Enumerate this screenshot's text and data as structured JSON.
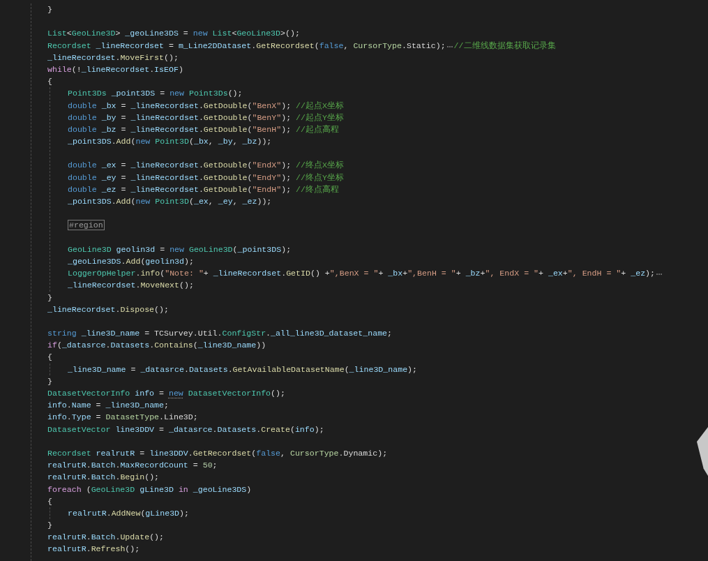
{
  "editor": {
    "lines": [
      {
        "kind": "code",
        "tokens": [
          {
            "kind": "plain",
            "text": "}"
          }
        ]
      },
      {
        "kind": "blank"
      },
      {
        "kind": "code",
        "tokens": [
          {
            "kind": "type",
            "text": "List"
          },
          {
            "kind": "plain",
            "text": "<"
          },
          {
            "kind": "type",
            "text": "GeoLine3D"
          },
          {
            "kind": "plain",
            "text": "> "
          },
          {
            "kind": "var",
            "text": "_geoLine3DS"
          },
          {
            "kind": "plain",
            "text": " = "
          },
          {
            "kind": "kw",
            "text": "new"
          },
          {
            "kind": "type",
            "text": " List"
          },
          {
            "kind": "plain",
            "text": "<"
          },
          {
            "kind": "type",
            "text": "GeoLine3D"
          },
          {
            "kind": "plain",
            "text": ">();"
          }
        ]
      },
      {
        "kind": "code",
        "tokens": [
          {
            "kind": "type",
            "text": "Recordset"
          },
          {
            "kind": "var",
            "text": " _lineRecordset"
          },
          {
            "kind": "plain",
            "text": " = "
          },
          {
            "kind": "var",
            "text": "m_Line2DDataset"
          },
          {
            "kind": "plain",
            "text": "."
          },
          {
            "kind": "method",
            "text": "GetRecordset"
          },
          {
            "kind": "plain",
            "text": "("
          },
          {
            "kind": "kw",
            "text": "false"
          },
          {
            "kind": "plain",
            "text": ", "
          },
          {
            "kind": "enum",
            "text": "CursorType"
          },
          {
            "kind": "plain",
            "text": ".Static);"
          },
          {
            "kind": "hint"
          },
          {
            "kind": "comment",
            "text": "//二维线数据集获取记录集"
          }
        ]
      },
      {
        "kind": "code",
        "tokens": [
          {
            "kind": "var",
            "text": "_lineRecordset"
          },
          {
            "kind": "plain",
            "text": "."
          },
          {
            "kind": "method",
            "text": "MoveFirst"
          },
          {
            "kind": "plain",
            "text": "();"
          }
        ]
      },
      {
        "kind": "code",
        "tokens": [
          {
            "kind": "ctrl",
            "text": "while"
          },
          {
            "kind": "plain",
            "text": "(!"
          },
          {
            "kind": "var",
            "text": "_lineRecordset"
          },
          {
            "kind": "plain",
            "text": "."
          },
          {
            "kind": "var",
            "text": "IsEOF"
          },
          {
            "kind": "plain",
            "text": ")"
          }
        ]
      },
      {
        "kind": "block",
        "open": "{",
        "close": "}",
        "children": [
          {
            "kind": "code",
            "tokens": [
              {
                "kind": "type",
                "text": "Point3Ds"
              },
              {
                "kind": "var",
                "text": " _point3DS"
              },
              {
                "kind": "plain",
                "text": " = "
              },
              {
                "kind": "kw",
                "text": "new"
              },
              {
                "kind": "type",
                "text": " Point3Ds"
              },
              {
                "kind": "plain",
                "text": "();"
              }
            ]
          },
          {
            "kind": "code",
            "tokens": [
              {
                "kind": "kw",
                "text": "double"
              },
              {
                "kind": "var",
                "text": " _bx"
              },
              {
                "kind": "plain",
                "text": " = "
              },
              {
                "kind": "var",
                "text": "_lineRecordset"
              },
              {
                "kind": "plain",
                "text": "."
              },
              {
                "kind": "method",
                "text": "GetDouble"
              },
              {
                "kind": "plain",
                "text": "("
              },
              {
                "kind": "str",
                "text": "\"BenX\""
              },
              {
                "kind": "plain",
                "text": "); "
              },
              {
                "kind": "comment",
                "text": "//起点X坐标"
              }
            ]
          },
          {
            "kind": "code",
            "tokens": [
              {
                "kind": "kw",
                "text": "double"
              },
              {
                "kind": "var",
                "text": " _by"
              },
              {
                "kind": "plain",
                "text": " = "
              },
              {
                "kind": "var",
                "text": "_lineRecordset"
              },
              {
                "kind": "plain",
                "text": "."
              },
              {
                "kind": "method",
                "text": "GetDouble"
              },
              {
                "kind": "plain",
                "text": "("
              },
              {
                "kind": "str",
                "text": "\"BenY\""
              },
              {
                "kind": "plain",
                "text": "); "
              },
              {
                "kind": "comment",
                "text": "//起点Y坐标"
              }
            ]
          },
          {
            "kind": "code",
            "tokens": [
              {
                "kind": "kw",
                "text": "double"
              },
              {
                "kind": "var",
                "text": " _bz"
              },
              {
                "kind": "plain",
                "text": " = "
              },
              {
                "kind": "var",
                "text": "_lineRecordset"
              },
              {
                "kind": "plain",
                "text": "."
              },
              {
                "kind": "method",
                "text": "GetDouble"
              },
              {
                "kind": "plain",
                "text": "("
              },
              {
                "kind": "str",
                "text": "\"BenH\""
              },
              {
                "kind": "plain",
                "text": "); "
              },
              {
                "kind": "comment",
                "text": "//起点高程"
              }
            ]
          },
          {
            "kind": "code",
            "tokens": [
              {
                "kind": "var",
                "text": "_point3DS"
              },
              {
                "kind": "plain",
                "text": "."
              },
              {
                "kind": "method",
                "text": "Add"
              },
              {
                "kind": "plain",
                "text": "("
              },
              {
                "kind": "kw",
                "text": "new"
              },
              {
                "kind": "type",
                "text": " Point3D"
              },
              {
                "kind": "plain",
                "text": "("
              },
              {
                "kind": "var",
                "text": "_bx"
              },
              {
                "kind": "plain",
                "text": ", "
              },
              {
                "kind": "var",
                "text": "_by"
              },
              {
                "kind": "plain",
                "text": ", "
              },
              {
                "kind": "var",
                "text": "_bz"
              },
              {
                "kind": "plain",
                "text": "));"
              }
            ]
          },
          {
            "kind": "blank"
          },
          {
            "kind": "code",
            "tokens": [
              {
                "kind": "kw",
                "text": "double"
              },
              {
                "kind": "var",
                "text": " _ex"
              },
              {
                "kind": "plain",
                "text": " = "
              },
              {
                "kind": "var",
                "text": "_lineRecordset"
              },
              {
                "kind": "plain",
                "text": "."
              },
              {
                "kind": "method",
                "text": "GetDouble"
              },
              {
                "kind": "plain",
                "text": "("
              },
              {
                "kind": "str",
                "text": "\"EndX\""
              },
              {
                "kind": "plain",
                "text": "); "
              },
              {
                "kind": "comment",
                "text": "//终点X坐标"
              }
            ]
          },
          {
            "kind": "code",
            "tokens": [
              {
                "kind": "kw",
                "text": "double"
              },
              {
                "kind": "var",
                "text": " _ey"
              },
              {
                "kind": "plain",
                "text": " = "
              },
              {
                "kind": "var",
                "text": "_lineRecordset"
              },
              {
                "kind": "plain",
                "text": "."
              },
              {
                "kind": "method",
                "text": "GetDouble"
              },
              {
                "kind": "plain",
                "text": "("
              },
              {
                "kind": "str",
                "text": "\"EndY\""
              },
              {
                "kind": "plain",
                "text": "); "
              },
              {
                "kind": "comment",
                "text": "//终点Y坐标"
              }
            ]
          },
          {
            "kind": "code",
            "tokens": [
              {
                "kind": "kw",
                "text": "double"
              },
              {
                "kind": "var",
                "text": " _ez"
              },
              {
                "kind": "plain",
                "text": " = "
              },
              {
                "kind": "var",
                "text": "_lineRecordset"
              },
              {
                "kind": "plain",
                "text": "."
              },
              {
                "kind": "method",
                "text": "GetDouble"
              },
              {
                "kind": "plain",
                "text": "("
              },
              {
                "kind": "str",
                "text": "\"EndH\""
              },
              {
                "kind": "plain",
                "text": "); "
              },
              {
                "kind": "comment",
                "text": "//终点高程"
              }
            ]
          },
          {
            "kind": "code",
            "tokens": [
              {
                "kind": "var",
                "text": "_point3DS"
              },
              {
                "kind": "plain",
                "text": "."
              },
              {
                "kind": "method",
                "text": "Add"
              },
              {
                "kind": "plain",
                "text": "("
              },
              {
                "kind": "kw",
                "text": "new"
              },
              {
                "kind": "type",
                "text": " Point3D"
              },
              {
                "kind": "plain",
                "text": "("
              },
              {
                "kind": "var",
                "text": "_ex"
              },
              {
                "kind": "plain",
                "text": ", "
              },
              {
                "kind": "var",
                "text": "_ey"
              },
              {
                "kind": "plain",
                "text": ", "
              },
              {
                "kind": "var",
                "text": "_ez"
              },
              {
                "kind": "plain",
                "text": "));"
              }
            ]
          },
          {
            "kind": "blank"
          },
          {
            "kind": "region",
            "text": "#region"
          },
          {
            "kind": "blank"
          },
          {
            "kind": "code",
            "tokens": [
              {
                "kind": "type",
                "text": "GeoLine3D"
              },
              {
                "kind": "var",
                "text": " geolin3d"
              },
              {
                "kind": "plain",
                "text": " = "
              },
              {
                "kind": "kw",
                "text": "new"
              },
              {
                "kind": "type",
                "text": " GeoLine3D"
              },
              {
                "kind": "plain",
                "text": "("
              },
              {
                "kind": "var",
                "text": "_point3DS"
              },
              {
                "kind": "plain",
                "text": ");"
              }
            ]
          },
          {
            "kind": "code",
            "tokens": [
              {
                "kind": "var",
                "text": "_geoLine3DS"
              },
              {
                "kind": "plain",
                "text": "."
              },
              {
                "kind": "method",
                "text": "Add"
              },
              {
                "kind": "plain",
                "text": "("
              },
              {
                "kind": "var",
                "text": "geolin3d"
              },
              {
                "kind": "plain",
                "text": ");"
              }
            ]
          },
          {
            "kind": "code",
            "tokens": [
              {
                "kind": "type",
                "text": "LoggerOpHelper"
              },
              {
                "kind": "plain",
                "text": "."
              },
              {
                "kind": "method",
                "text": "info"
              },
              {
                "kind": "plain",
                "text": "("
              },
              {
                "kind": "str",
                "text": "\"Note: \""
              },
              {
                "kind": "plain",
                "text": "+ "
              },
              {
                "kind": "var",
                "text": "_lineRecordset"
              },
              {
                "kind": "plain",
                "text": "."
              },
              {
                "kind": "method",
                "text": "GetID"
              },
              {
                "kind": "plain",
                "text": "() +"
              },
              {
                "kind": "str",
                "text": "\",BenX = \""
              },
              {
                "kind": "plain",
                "text": "+ "
              },
              {
                "kind": "var",
                "text": "_bx"
              },
              {
                "kind": "plain",
                "text": "+"
              },
              {
                "kind": "str",
                "text": "\",BenH = \""
              },
              {
                "kind": "plain",
                "text": "+ "
              },
              {
                "kind": "var",
                "text": "_bz"
              },
              {
                "kind": "plain",
                "text": "+"
              },
              {
                "kind": "str",
                "text": "\", EndX = \""
              },
              {
                "kind": "plain",
                "text": "+ "
              },
              {
                "kind": "var",
                "text": "_ex"
              },
              {
                "kind": "plain",
                "text": "+"
              },
              {
                "kind": "str",
                "text": "\", EndH = \""
              },
              {
                "kind": "plain",
                "text": "+ "
              },
              {
                "kind": "var",
                "text": "_ez"
              },
              {
                "kind": "plain",
                "text": ");"
              },
              {
                "kind": "hint"
              }
            ]
          },
          {
            "kind": "code",
            "tokens": [
              {
                "kind": "var",
                "text": "_lineRecordset"
              },
              {
                "kind": "plain",
                "text": "."
              },
              {
                "kind": "method",
                "text": "MoveNext"
              },
              {
                "kind": "plain",
                "text": "();"
              }
            ]
          }
        ]
      },
      {
        "kind": "code",
        "tokens": [
          {
            "kind": "var",
            "text": "_lineRecordset"
          },
          {
            "kind": "plain",
            "text": "."
          },
          {
            "kind": "method",
            "text": "Dispose"
          },
          {
            "kind": "plain",
            "text": "();"
          }
        ]
      },
      {
        "kind": "blank"
      },
      {
        "kind": "code",
        "tokens": [
          {
            "kind": "kw",
            "text": "string"
          },
          {
            "kind": "var",
            "text": " _line3D_name"
          },
          {
            "kind": "plain",
            "text": " = TCSurvey.Util."
          },
          {
            "kind": "type",
            "text": "ConfigStr"
          },
          {
            "kind": "plain",
            "text": "."
          },
          {
            "kind": "var",
            "text": "_all_line3D_dataset_name"
          },
          {
            "kind": "plain",
            "text": ";"
          }
        ]
      },
      {
        "kind": "code",
        "tokens": [
          {
            "kind": "ctrl",
            "text": "if"
          },
          {
            "kind": "plain",
            "text": "("
          },
          {
            "kind": "var",
            "text": "_datasrce"
          },
          {
            "kind": "plain",
            "text": "."
          },
          {
            "kind": "var",
            "text": "Datasets"
          },
          {
            "kind": "plain",
            "text": "."
          },
          {
            "kind": "method",
            "text": "Contains"
          },
          {
            "kind": "plain",
            "text": "("
          },
          {
            "kind": "var",
            "text": "_line3D_name"
          },
          {
            "kind": "plain",
            "text": "))"
          }
        ]
      },
      {
        "kind": "block",
        "open": "{",
        "close": "}",
        "children": [
          {
            "kind": "code",
            "tokens": [
              {
                "kind": "var",
                "text": "_line3D_name"
              },
              {
                "kind": "plain",
                "text": " = "
              },
              {
                "kind": "var",
                "text": "_datasrce"
              },
              {
                "kind": "plain",
                "text": "."
              },
              {
                "kind": "var",
                "text": "Datasets"
              },
              {
                "kind": "plain",
                "text": "."
              },
              {
                "kind": "method",
                "text": "GetAvailableDatasetName"
              },
              {
                "kind": "plain",
                "text": "("
              },
              {
                "kind": "var",
                "text": "_line3D_name"
              },
              {
                "kind": "plain",
                "text": ");"
              }
            ]
          }
        ]
      },
      {
        "kind": "code",
        "tokens": [
          {
            "kind": "type",
            "text": "DatasetVectorInfo"
          },
          {
            "kind": "var",
            "text": " info"
          },
          {
            "kind": "plain",
            "text": " = "
          },
          {
            "kind": "kw-hinted",
            "text": "new"
          },
          {
            "kind": "type",
            "text": " DatasetVectorInfo"
          },
          {
            "kind": "plain",
            "text": "();"
          }
        ]
      },
      {
        "kind": "code",
        "tokens": [
          {
            "kind": "var",
            "text": "info"
          },
          {
            "kind": "plain",
            "text": "."
          },
          {
            "kind": "var",
            "text": "Name"
          },
          {
            "kind": "plain",
            "text": " = "
          },
          {
            "kind": "var",
            "text": "_line3D_name"
          },
          {
            "kind": "plain",
            "text": ";"
          }
        ]
      },
      {
        "kind": "code",
        "tokens": [
          {
            "kind": "var",
            "text": "info"
          },
          {
            "kind": "plain",
            "text": "."
          },
          {
            "kind": "var",
            "text": "Type"
          },
          {
            "kind": "plain",
            "text": " = "
          },
          {
            "kind": "enum",
            "text": "DatasetType"
          },
          {
            "kind": "plain",
            "text": ".Line3D;"
          }
        ]
      },
      {
        "kind": "code",
        "tokens": [
          {
            "kind": "type",
            "text": "DatasetVector"
          },
          {
            "kind": "var",
            "text": " line3DDV"
          },
          {
            "kind": "plain",
            "text": " = "
          },
          {
            "kind": "var",
            "text": "_datasrce"
          },
          {
            "kind": "plain",
            "text": "."
          },
          {
            "kind": "var",
            "text": "Datasets"
          },
          {
            "kind": "plain",
            "text": "."
          },
          {
            "kind": "method",
            "text": "Create"
          },
          {
            "kind": "plain",
            "text": "("
          },
          {
            "kind": "var",
            "text": "info"
          },
          {
            "kind": "plain",
            "text": ");"
          }
        ]
      },
      {
        "kind": "blank"
      },
      {
        "kind": "code",
        "tokens": [
          {
            "kind": "type",
            "text": "Recordset"
          },
          {
            "kind": "var",
            "text": " realrutR"
          },
          {
            "kind": "plain",
            "text": " = "
          },
          {
            "kind": "var",
            "text": "line3DDV"
          },
          {
            "kind": "plain",
            "text": "."
          },
          {
            "kind": "method",
            "text": "GetRecordset"
          },
          {
            "kind": "plain",
            "text": "("
          },
          {
            "kind": "kw",
            "text": "false"
          },
          {
            "kind": "plain",
            "text": ", "
          },
          {
            "kind": "enum",
            "text": "CursorType"
          },
          {
            "kind": "plain",
            "text": ".Dynamic);"
          }
        ]
      },
      {
        "kind": "code",
        "tokens": [
          {
            "kind": "var",
            "text": "realrutR"
          },
          {
            "kind": "plain",
            "text": "."
          },
          {
            "kind": "var",
            "text": "Batch"
          },
          {
            "kind": "plain",
            "text": "."
          },
          {
            "kind": "var",
            "text": "MaxRecordCount"
          },
          {
            "kind": "plain",
            "text": " = "
          },
          {
            "kind": "num",
            "text": "50"
          },
          {
            "kind": "plain",
            "text": ";"
          }
        ]
      },
      {
        "kind": "code",
        "tokens": [
          {
            "kind": "var",
            "text": "realrutR"
          },
          {
            "kind": "plain",
            "text": "."
          },
          {
            "kind": "var",
            "text": "Batch"
          },
          {
            "kind": "plain",
            "text": "."
          },
          {
            "kind": "method",
            "text": "Begin"
          },
          {
            "kind": "plain",
            "text": "();"
          }
        ]
      },
      {
        "kind": "code",
        "tokens": [
          {
            "kind": "ctrl",
            "text": "foreach"
          },
          {
            "kind": "plain",
            "text": " ("
          },
          {
            "kind": "type",
            "text": "GeoLine3D"
          },
          {
            "kind": "var",
            "text": " gLine3D"
          },
          {
            "kind": "ctrl",
            "text": " in"
          },
          {
            "kind": "var",
            "text": " _geoLine3DS"
          },
          {
            "kind": "plain",
            "text": ")"
          }
        ]
      },
      {
        "kind": "block",
        "open": "{",
        "close": "}",
        "children": [
          {
            "kind": "code",
            "tokens": [
              {
                "kind": "var",
                "text": "realrutR"
              },
              {
                "kind": "plain",
                "text": "."
              },
              {
                "kind": "method",
                "text": "AddNew"
              },
              {
                "kind": "plain",
                "text": "("
              },
              {
                "kind": "var",
                "text": "gLine3D"
              },
              {
                "kind": "plain",
                "text": ");"
              }
            ]
          }
        ]
      },
      {
        "kind": "code",
        "tokens": [
          {
            "kind": "var",
            "text": "realrutR"
          },
          {
            "kind": "plain",
            "text": "."
          },
          {
            "kind": "var",
            "text": "Batch"
          },
          {
            "kind": "plain",
            "text": "."
          },
          {
            "kind": "method",
            "text": "Update"
          },
          {
            "kind": "plain",
            "text": "();"
          }
        ]
      },
      {
        "kind": "code",
        "tokens": [
          {
            "kind": "var",
            "text": "realrutR"
          },
          {
            "kind": "plain",
            "text": "."
          },
          {
            "kind": "method",
            "text": "Refresh"
          },
          {
            "kind": "plain",
            "text": "();"
          }
        ]
      }
    ]
  }
}
